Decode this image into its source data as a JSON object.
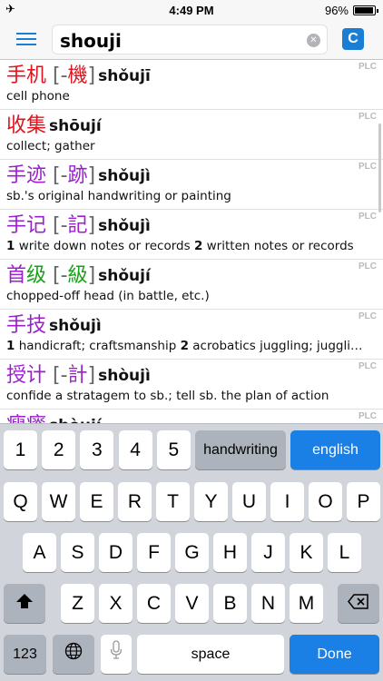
{
  "status": {
    "time": "4:49 PM",
    "battery_text": "96%",
    "battery_level": 0.96,
    "airplane_icon": "airplane-icon"
  },
  "search": {
    "value": "shouji",
    "menu_icon": "hamburger-menu-icon",
    "clear_icon": "clear-icon",
    "c_label": "C"
  },
  "results": [
    {
      "hz": [
        {
          "t": "手机",
          "c": "red"
        },
        {
          "t": " [-",
          "c": "gray"
        },
        {
          "t": "機",
          "c": "red"
        },
        {
          "t": "]",
          "c": "gray"
        }
      ],
      "pinyin": "shǒujī",
      "def": "cell phone",
      "tag": "PLC"
    },
    {
      "hz": [
        {
          "t": "收集",
          "c": "red"
        }
      ],
      "pinyin": "shōují",
      "def": "collect; gather",
      "tag": "PLC"
    },
    {
      "hz": [
        {
          "t": "手迹",
          "c": "purple"
        },
        {
          "t": " [-",
          "c": "gray"
        },
        {
          "t": "跡",
          "c": "purple"
        },
        {
          "t": "]",
          "c": "gray"
        }
      ],
      "pinyin": "shǒujì",
      "def": "sb.'s original handwriting or painting",
      "tag": "PLC"
    },
    {
      "hz": [
        {
          "t": "手记",
          "c": "purple"
        },
        {
          "t": " [-",
          "c": "gray"
        },
        {
          "t": "記",
          "c": "purple"
        },
        {
          "t": "]",
          "c": "gray"
        }
      ],
      "pinyin": "shǒujì",
      "def_parts": [
        {
          "n": "1",
          "t": " write down notes or records  "
        },
        {
          "n": "2",
          "t": " written notes or records"
        }
      ],
      "tag": "PLC"
    },
    {
      "hz": [
        {
          "t": "首",
          "c": "purple"
        },
        {
          "t": "级",
          "c": "green"
        },
        {
          "t": " [-",
          "c": "gray"
        },
        {
          "t": "級",
          "c": "green"
        },
        {
          "t": "]",
          "c": "gray"
        }
      ],
      "pinyin": "shǒují",
      "def": "chopped-off head (in battle, etc.)",
      "tag": "PLC"
    },
    {
      "hz": [
        {
          "t": "手技",
          "c": "purple"
        }
      ],
      "pinyin": "shǒujì",
      "def_parts": [
        {
          "n": "1",
          "t": " handicraft; craftsmanship  "
        },
        {
          "n": "2",
          "t": " acrobatics juggling; juggling skill"
        }
      ],
      "tag": "PLC"
    },
    {
      "hz": [
        {
          "t": "授计",
          "c": "purple"
        },
        {
          "t": " [-",
          "c": "gray"
        },
        {
          "t": "計",
          "c": "purple"
        },
        {
          "t": "]",
          "c": "gray"
        }
      ],
      "pinyin": "shòujì",
      "def": "confide a stratagem to sb.; tell sb. the plan of action",
      "tag": "PLC"
    },
    {
      "hz": [
        {
          "t": "瘦瘠",
          "c": "purple"
        }
      ],
      "pinyin": "shòují",
      "def": "",
      "tag": "PLC"
    }
  ],
  "keyboard": {
    "row1": [
      "1",
      "2",
      "3",
      "4",
      "5"
    ],
    "handwriting": "handwriting",
    "english": "english",
    "row2": [
      "Q",
      "W",
      "E",
      "R",
      "T",
      "Y",
      "U",
      "I",
      "O",
      "P"
    ],
    "row3": [
      "A",
      "S",
      "D",
      "F",
      "G",
      "H",
      "J",
      "K",
      "L"
    ],
    "row4": [
      "Z",
      "X",
      "C",
      "V",
      "B",
      "N",
      "M"
    ],
    "numbers": "123",
    "space": "space",
    "done": "Done",
    "icons": {
      "shift": "shift-icon",
      "delete": "delete-icon",
      "globe": "globe-icon",
      "mic": "microphone-icon"
    }
  },
  "colors": {
    "accent": "#1a7fd4",
    "red": "#e0141e",
    "purple": "#9b1fcf",
    "green": "#1aa11a"
  }
}
